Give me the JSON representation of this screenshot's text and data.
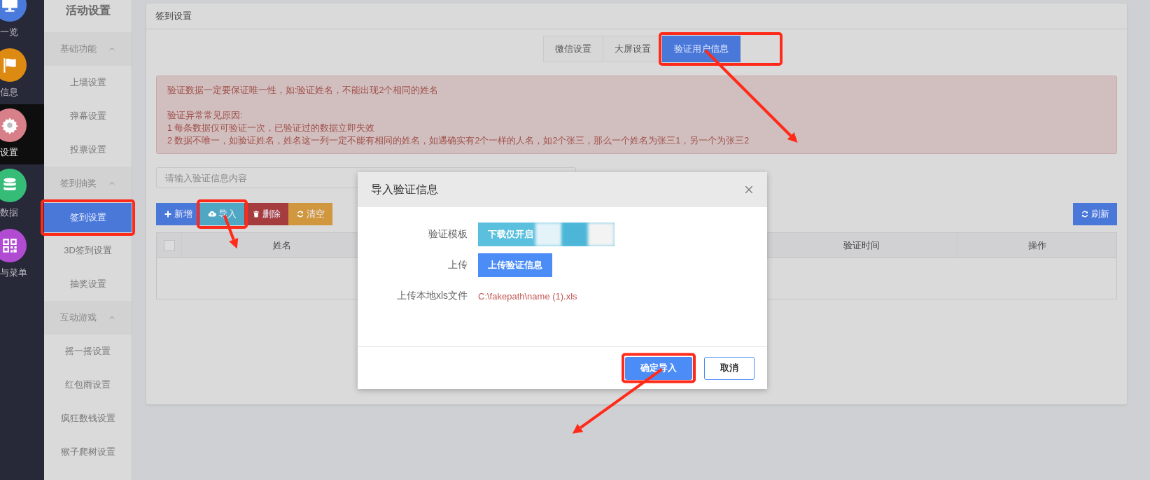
{
  "nav_rail": {
    "items": [
      {
        "label": "一览",
        "kind": "monitor",
        "color": "#4a7bdc",
        "selected": false
      },
      {
        "label": "信息",
        "kind": "flag",
        "color": "#dd8a12",
        "selected": false
      },
      {
        "label": "设置",
        "kind": "gear",
        "color": "#d8808a",
        "selected": true
      },
      {
        "label": "数据",
        "kind": "database",
        "color": "#35bd78",
        "selected": false
      },
      {
        "label": "与菜单",
        "kind": "qrcode",
        "color": "#b04bd2",
        "selected": false
      }
    ]
  },
  "sidebar": {
    "title": "活动设置",
    "groups": [
      {
        "label": "基础功能",
        "expanded": true,
        "children": [
          {
            "label": "上墙设置",
            "selected": false
          },
          {
            "label": "弹幕设置",
            "selected": false
          },
          {
            "label": "投票设置",
            "selected": false
          }
        ]
      },
      {
        "label": "签到抽奖",
        "expanded": true,
        "children": [
          {
            "label": "签到设置",
            "selected": true,
            "annotated": true
          },
          {
            "label": "3D签到设置",
            "selected": false
          },
          {
            "label": "抽奖设置",
            "selected": false
          }
        ]
      },
      {
        "label": "互动游戏",
        "expanded": true,
        "children": [
          {
            "label": "摇一摇设置",
            "selected": false
          },
          {
            "label": "红包雨设置",
            "selected": false
          },
          {
            "label": "疯狂数钱设置",
            "selected": false
          },
          {
            "label": "猴子爬树设置",
            "selected": false
          }
        ]
      }
    ]
  },
  "panel": {
    "title": "签到设置",
    "tabs": [
      {
        "label": "微信设置",
        "selected": false
      },
      {
        "label": "大屏设置",
        "selected": false
      },
      {
        "label": "验证用户信息",
        "selected": true,
        "annotated": true,
        "with_arrow": true
      }
    ],
    "notice": {
      "paragraphs": [
        [
          "验证数据一定要保证唯一性，如:验证姓名，不能出现2个相同的姓名"
        ],
        [
          "验证异常常见原因:",
          "1 每条数据仅可验证一次，已验证过的数据立即失效",
          "2 数据不唯一，如验证姓名，姓名这一列一定不能有相同的姓名，如遇确实有2个一样的人名，如2个张三，那么一个姓名为张三1，另一个为张三2"
        ]
      ]
    },
    "search": {
      "placeholder": "请输入验证信息内容"
    },
    "toolbar": [
      {
        "label": "新增",
        "kind": "add"
      },
      {
        "label": "导入",
        "kind": "import",
        "annotated": true,
        "with_arrow": true
      },
      {
        "label": "删除",
        "kind": "delete"
      },
      {
        "label": "清空",
        "kind": "clear"
      }
    ],
    "refresh_button": {
      "label": "刷新",
      "kind": "refresh"
    },
    "table": {
      "columns": [
        {
          "kind": "checkbox",
          "checked": false
        },
        {
          "kind": "text",
          "label": "姓名"
        },
        {
          "kind": "text",
          "label": "验证时间"
        },
        {
          "kind": "text",
          "label": "操作"
        }
      ]
    }
  },
  "dialog": {
    "title": "导入验证信息",
    "fields": [
      {
        "label": "验证模板",
        "kind": "download",
        "value": "下载仅开启",
        "redacted": true
      },
      {
        "label": "上传",
        "kind": "upload",
        "value": "上传验证信息"
      },
      {
        "label": "上传本地xls文件",
        "kind": "file",
        "value": "C:\\fakepath\\name (1).xls"
      }
    ],
    "buttons": [
      {
        "label": "确定导入",
        "kind": "primary",
        "annotated": true,
        "with_arrow": true
      },
      {
        "label": "取消",
        "kind": "secondary"
      }
    ]
  }
}
